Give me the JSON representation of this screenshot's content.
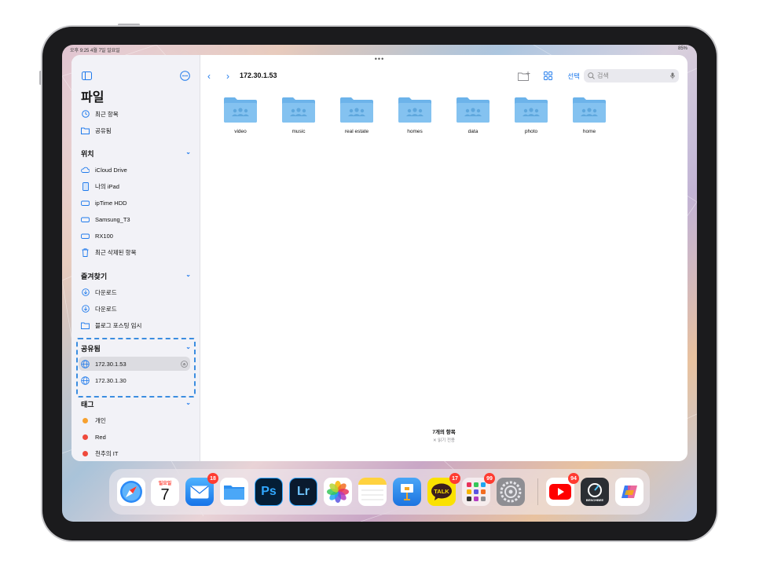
{
  "status_bar": {
    "time_date": "오후 9:25  4월 7일 일요일",
    "battery": "85%"
  },
  "sidebar": {
    "title": "파일",
    "top_items": [
      {
        "label": "최근 항목",
        "icon": "clock-icon"
      },
      {
        "label": "공유됨",
        "icon": "shared-folder-icon"
      }
    ],
    "sections": {
      "locations": {
        "title": "위치",
        "items": [
          {
            "label": "iCloud Drive",
            "icon": "cloud-icon"
          },
          {
            "label": "나의 iPad",
            "icon": "ipad-icon"
          },
          {
            "label": "ipTime HDD",
            "icon": "drive-icon"
          },
          {
            "label": "Samsung_T3",
            "icon": "drive-icon"
          },
          {
            "label": "RX100",
            "icon": "drive-icon"
          },
          {
            "label": "최근 삭제된 항목",
            "icon": "trash-icon"
          }
        ]
      },
      "favorites": {
        "title": "즐겨찾기",
        "items": [
          {
            "label": "다운로드",
            "icon": "download-icon"
          },
          {
            "label": "다운로드",
            "icon": "download-icon"
          },
          {
            "label": "블로그 포스팅 임시",
            "icon": "folder-icon"
          }
        ]
      },
      "shared": {
        "title": "공유됨",
        "items": [
          {
            "label": "172.30.1.53",
            "icon": "globe-icon",
            "selected": true
          },
          {
            "label": "172.30.1.30",
            "icon": "globe-icon",
            "selected": false
          }
        ]
      },
      "tags": {
        "title": "태그",
        "items": [
          {
            "label": "개인",
            "color": "#f7a12f"
          },
          {
            "label": "Red",
            "color": "#ef4a3c"
          },
          {
            "label": "천추의 IT",
            "color": "#ef4a3c"
          }
        ]
      }
    }
  },
  "toolbar": {
    "path_title": "172.30.1.53",
    "select_label": "선택",
    "search_placeholder": "검색"
  },
  "folders": [
    {
      "name": "video"
    },
    {
      "name": "music"
    },
    {
      "name": "real estate"
    },
    {
      "name": "homes"
    },
    {
      "name": "data"
    },
    {
      "name": "photo"
    },
    {
      "name": "home"
    }
  ],
  "footer": {
    "count": "7개의 항목",
    "read_only": "읽기 전용"
  },
  "dock": {
    "calendar_day": "일요일",
    "calendar_date": "7",
    "apps": [
      {
        "name": "Safari",
        "badge": ""
      },
      {
        "name": "Calendar",
        "badge": ""
      },
      {
        "name": "Mail",
        "badge": "18"
      },
      {
        "name": "Files",
        "badge": ""
      },
      {
        "name": "Ps",
        "badge": ""
      },
      {
        "name": "Lr",
        "badge": ""
      },
      {
        "name": "Photos",
        "badge": ""
      },
      {
        "name": "Notes",
        "badge": ""
      },
      {
        "name": "Keynote",
        "badge": ""
      },
      {
        "name": "TALK",
        "badge": "17"
      },
      {
        "name": "Folder",
        "badge": "99"
      },
      {
        "name": "Settings",
        "badge": ""
      },
      {
        "name": "YouTube",
        "badge": "94"
      },
      {
        "name": "BENCHBEE",
        "badge": ""
      },
      {
        "name": "Copilot",
        "badge": ""
      }
    ]
  },
  "colors": {
    "accent": "#1f7aec",
    "folder": "#6cb3ea",
    "selection": "#dcdce1",
    "highlight_box": "#3b8de0"
  }
}
